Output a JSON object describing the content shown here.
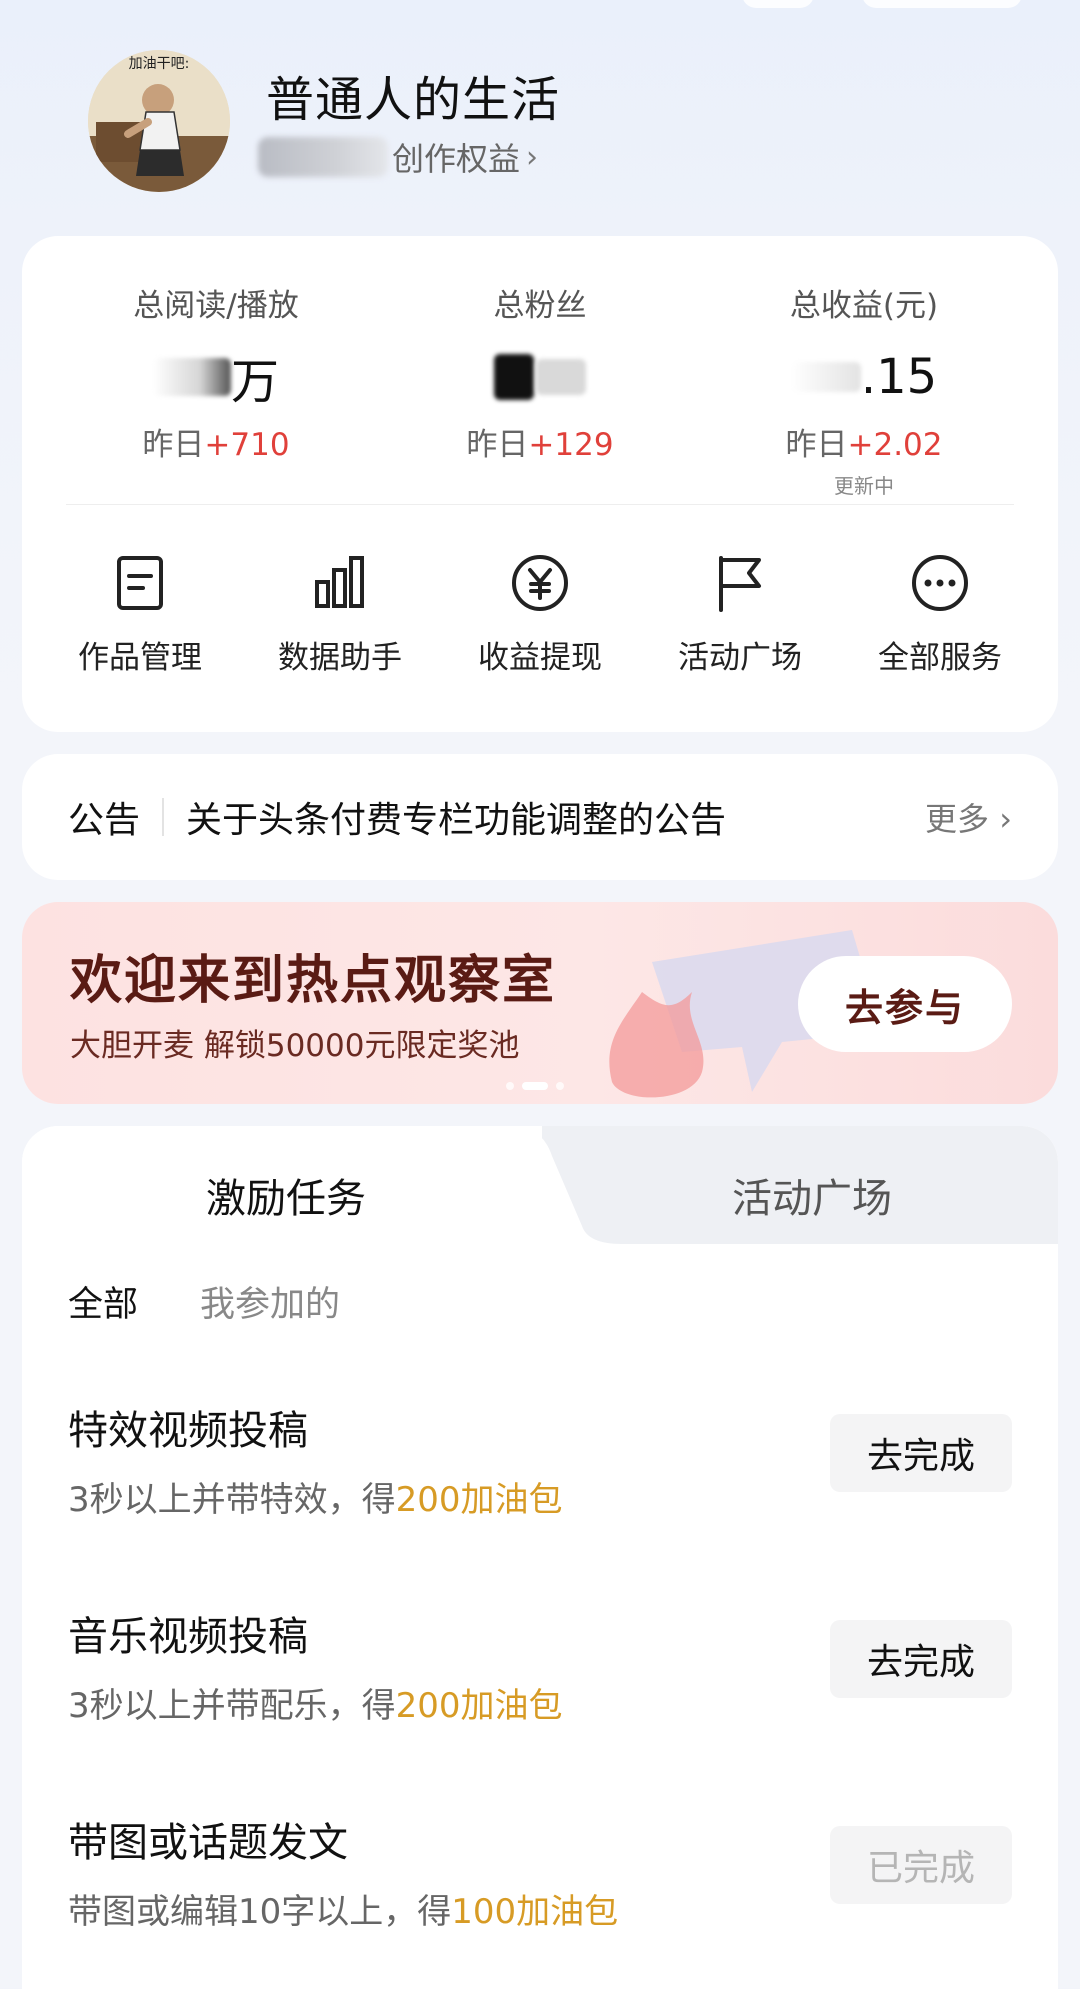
{
  "profile": {
    "username": "普通人的生活",
    "rights_link": "创作权益"
  },
  "stats": [
    {
      "label": "总阅读/播放",
      "value_suffix": "万",
      "delta_prefix": "昨日",
      "delta": "+710"
    },
    {
      "label": "总粉丝",
      "value_suffix": "",
      "delta_prefix": "昨日",
      "delta": "+129"
    },
    {
      "label": "总收益(元)",
      "value_suffix": ".15",
      "delta_prefix": "昨日",
      "delta": "+2.02",
      "note": "更新中"
    }
  ],
  "services": [
    {
      "label": "作品管理",
      "icon": "document-icon"
    },
    {
      "label": "数据助手",
      "icon": "bar-chart-icon"
    },
    {
      "label": "收益提现",
      "icon": "yen-icon"
    },
    {
      "label": "活动广场",
      "icon": "flag-icon"
    },
    {
      "label": "全部服务",
      "icon": "more-icon"
    }
  ],
  "notice": {
    "title": "公告",
    "text": "关于头条付费专栏功能调整的公告",
    "more": "更多"
  },
  "banner": {
    "title": "欢迎来到热点观察室",
    "subtitle": "大胆开麦 解锁50000元限定奖池",
    "button": "去参与"
  },
  "tasks_section": {
    "tabs": [
      "激励任务",
      "活动广场"
    ],
    "filters": [
      "全部",
      "我参加的"
    ],
    "items": [
      {
        "title": "特效视频投稿",
        "desc": "3秒以上并带特效，得",
        "reward": "200加油包",
        "button": "去完成",
        "done": false
      },
      {
        "title": "音乐视频投稿",
        "desc": "3秒以上并带配乐，得",
        "reward": "200加油包",
        "button": "去完成",
        "done": false
      },
      {
        "title": "带图或话题发文",
        "desc": "带图或编辑10字以上，得",
        "reward": "100加油包",
        "button": "已完成",
        "done": true
      }
    ]
  },
  "colors": {
    "accent_red": "#e0403a",
    "reward_gold": "#d79b25",
    "banner_text": "#5a1b14"
  }
}
